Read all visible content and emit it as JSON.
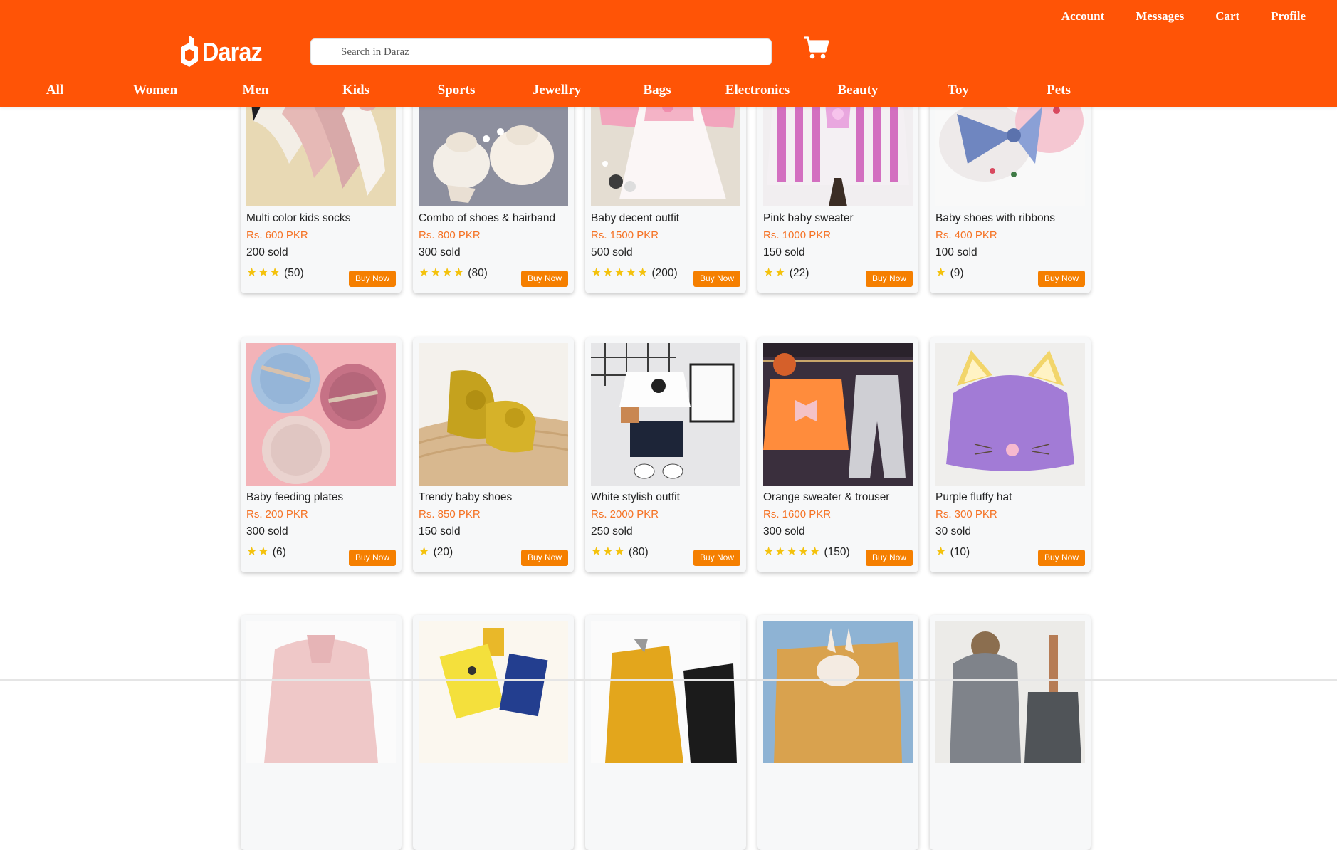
{
  "header": {
    "top_links": [
      "Account",
      "Messages",
      "Cart",
      "Profile"
    ],
    "logo_text": "Daraz",
    "search_placeholder": "Search in Daraz",
    "categories": [
      "All",
      "Women",
      "Men",
      "Kids",
      "Sports",
      "Jewellry",
      "Bags",
      "Electronics",
      "Beauty",
      "Toy",
      "Pets"
    ]
  },
  "colors": {
    "brand": "#ff5406",
    "price": "#f57224",
    "buy_button": "#f57f00",
    "star": "#f4c20d"
  },
  "buy_label": "Buy Now",
  "rows": [
    [
      {
        "title": "Multi color kids socks",
        "price": "Rs. 600 PKR",
        "sold": "200 sold",
        "stars": "★★★",
        "reviews": "(50)",
        "image": "socks-photo"
      },
      {
        "title": "Combo of shoes & hairband",
        "price": "Rs. 800 PKR",
        "sold": "300 sold",
        "stars": "★★★★",
        "reviews": "(80)",
        "image": "tutu-shoes-photo"
      },
      {
        "title": "Baby decent outfit",
        "price": "Rs. 1500 PKR",
        "sold": "500 sold",
        "stars": "★★★★★",
        "reviews": "(200)",
        "image": "pink-dress-photo"
      },
      {
        "title": "Pink baby sweater",
        "price": "Rs. 1000 PKR",
        "sold": "150 sold",
        "stars": "★★",
        "reviews": "(22)",
        "image": "striped-sweater-photo"
      },
      {
        "title": "Baby shoes with ribbons",
        "price": "Rs. 400 PKR",
        "sold": "100 sold",
        "stars": "★",
        "reviews": "(9)",
        "image": "ribbon-shoes-photo"
      }
    ],
    [
      {
        "title": "Baby feeding plates",
        "price": "Rs. 200 PKR",
        "sold": "300 sold",
        "stars": "★★",
        "reviews": "(6)",
        "image": "feeding-plates-photo"
      },
      {
        "title": "Trendy baby shoes",
        "price": "Rs. 850 PKR",
        "sold": "150 sold",
        "stars": "★",
        "reviews": "(20)",
        "image": "yellow-booties-photo"
      },
      {
        "title": "White stylish outfit",
        "price": "Rs. 2000 PKR",
        "sold": "250 sold",
        "stars": "★★★",
        "reviews": "(80)",
        "image": "white-outfit-photo"
      },
      {
        "title": "Orange sweater & trouser",
        "price": "Rs. 1600 PKR",
        "sold": "300 sold",
        "stars": "★★★★★",
        "reviews": "(150)",
        "image": "orange-sweater-photo"
      },
      {
        "title": "Purple fluffy hat",
        "price": "Rs. 300 PKR",
        "sold": "30 sold",
        "stars": "★",
        "reviews": "(10)",
        "image": "purple-hat-photo"
      }
    ],
    [
      {
        "image": "pink-jacket-photo"
      },
      {
        "image": "cartoon-socks-photo"
      },
      {
        "image": "yellow-tshirt-photo"
      },
      {
        "image": "bunny-scarf-photo"
      },
      {
        "image": "pompom-beanie-photo"
      }
    ]
  ]
}
